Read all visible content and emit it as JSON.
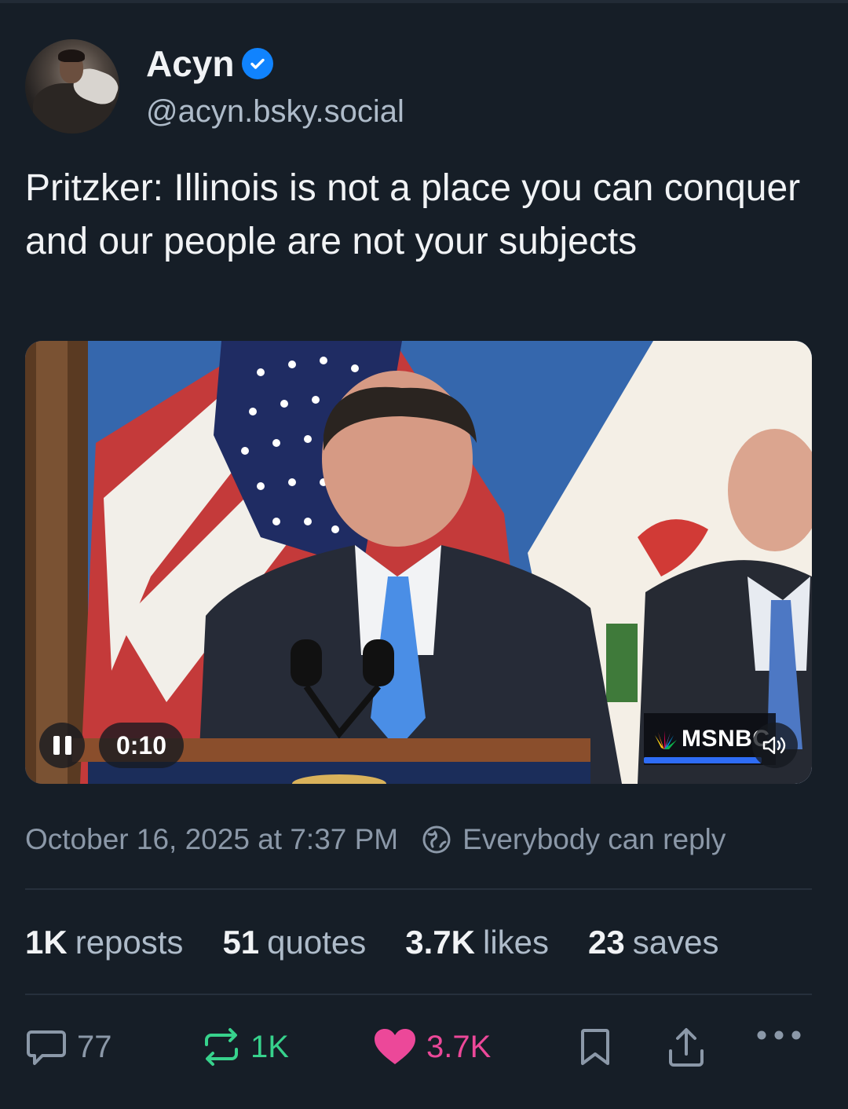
{
  "author": {
    "display_name": "Acyn",
    "handle": "@acyn.bsky.social",
    "verified": true
  },
  "post": {
    "text": "Pritzker: Illinois is not a place you can conquer and our people are not your subjects",
    "timestamp": "October 16, 2025 at 7:37 PM",
    "reply_setting": "Everybody can reply"
  },
  "video": {
    "elapsed": "0:10",
    "state": "playing",
    "muted": false,
    "network_logo": "MSNBC"
  },
  "stats": [
    {
      "count": "1K",
      "label": "reposts"
    },
    {
      "count": "51",
      "label": "quotes"
    },
    {
      "count": "3.7K",
      "label": "likes"
    },
    {
      "count": "23",
      "label": "saves"
    }
  ],
  "actions": {
    "reply_count": "77",
    "repost_count": "1K",
    "like_count": "3.7K",
    "like_active": true,
    "repost_color": "#37d28c",
    "like_color": "#ec4899"
  },
  "colors": {
    "background": "#161e27",
    "accent": "#1083fe",
    "muted_text": "#8b98a8"
  }
}
